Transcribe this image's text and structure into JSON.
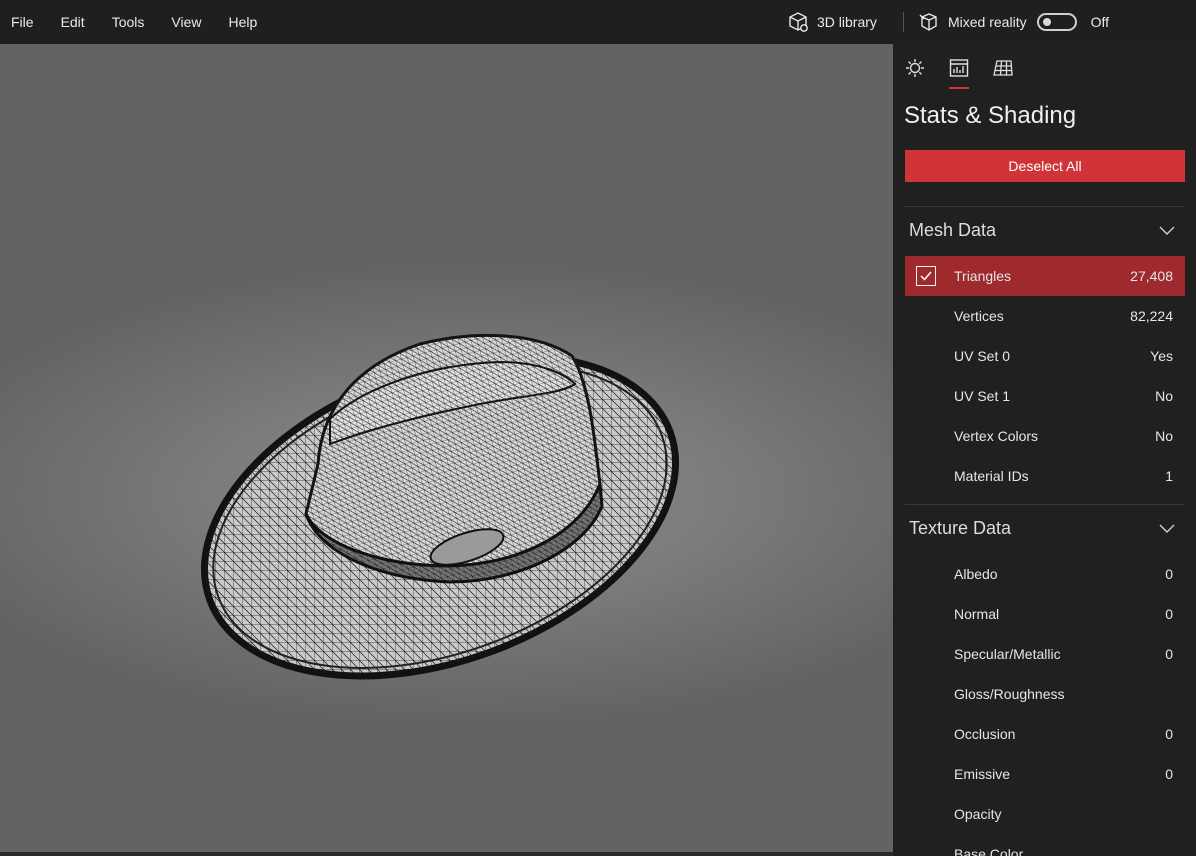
{
  "menu": [
    "File",
    "Edit",
    "Tools",
    "View",
    "Help"
  ],
  "topbar": {
    "library_label": "3D library",
    "mixed_reality_label": "Mixed reality",
    "mixed_reality_state": "Off"
  },
  "panel": {
    "tabs": [
      "sun-icon",
      "stats-icon",
      "grid-icon"
    ],
    "active_tab": 1,
    "title": "Stats & Shading",
    "deselect_label": "Deselect All",
    "mesh_section": {
      "title": "Mesh Data",
      "rows": [
        {
          "label": "Triangles",
          "value": "27,408",
          "selected": true
        },
        {
          "label": "Vertices",
          "value": "82,224"
        },
        {
          "label": "UV Set 0",
          "value": "Yes"
        },
        {
          "label": "UV Set 1",
          "value": "No"
        },
        {
          "label": "Vertex Colors",
          "value": "No"
        },
        {
          "label": "Material IDs",
          "value": "1"
        }
      ]
    },
    "texture_section": {
      "title": "Texture Data",
      "rows": [
        {
          "label": "Albedo",
          "value": "0"
        },
        {
          "label": "Normal",
          "value": "0"
        },
        {
          "label": "Specular/Metallic",
          "value": "0"
        },
        {
          "label": "Gloss/Roughness",
          "value": ""
        },
        {
          "label": "Occlusion",
          "value": "0"
        },
        {
          "label": "Emissive",
          "value": "0"
        },
        {
          "label": "Opacity",
          "value": ""
        },
        {
          "label": "Base Color",
          "value": ""
        }
      ]
    },
    "accent_color": "#d13438"
  }
}
